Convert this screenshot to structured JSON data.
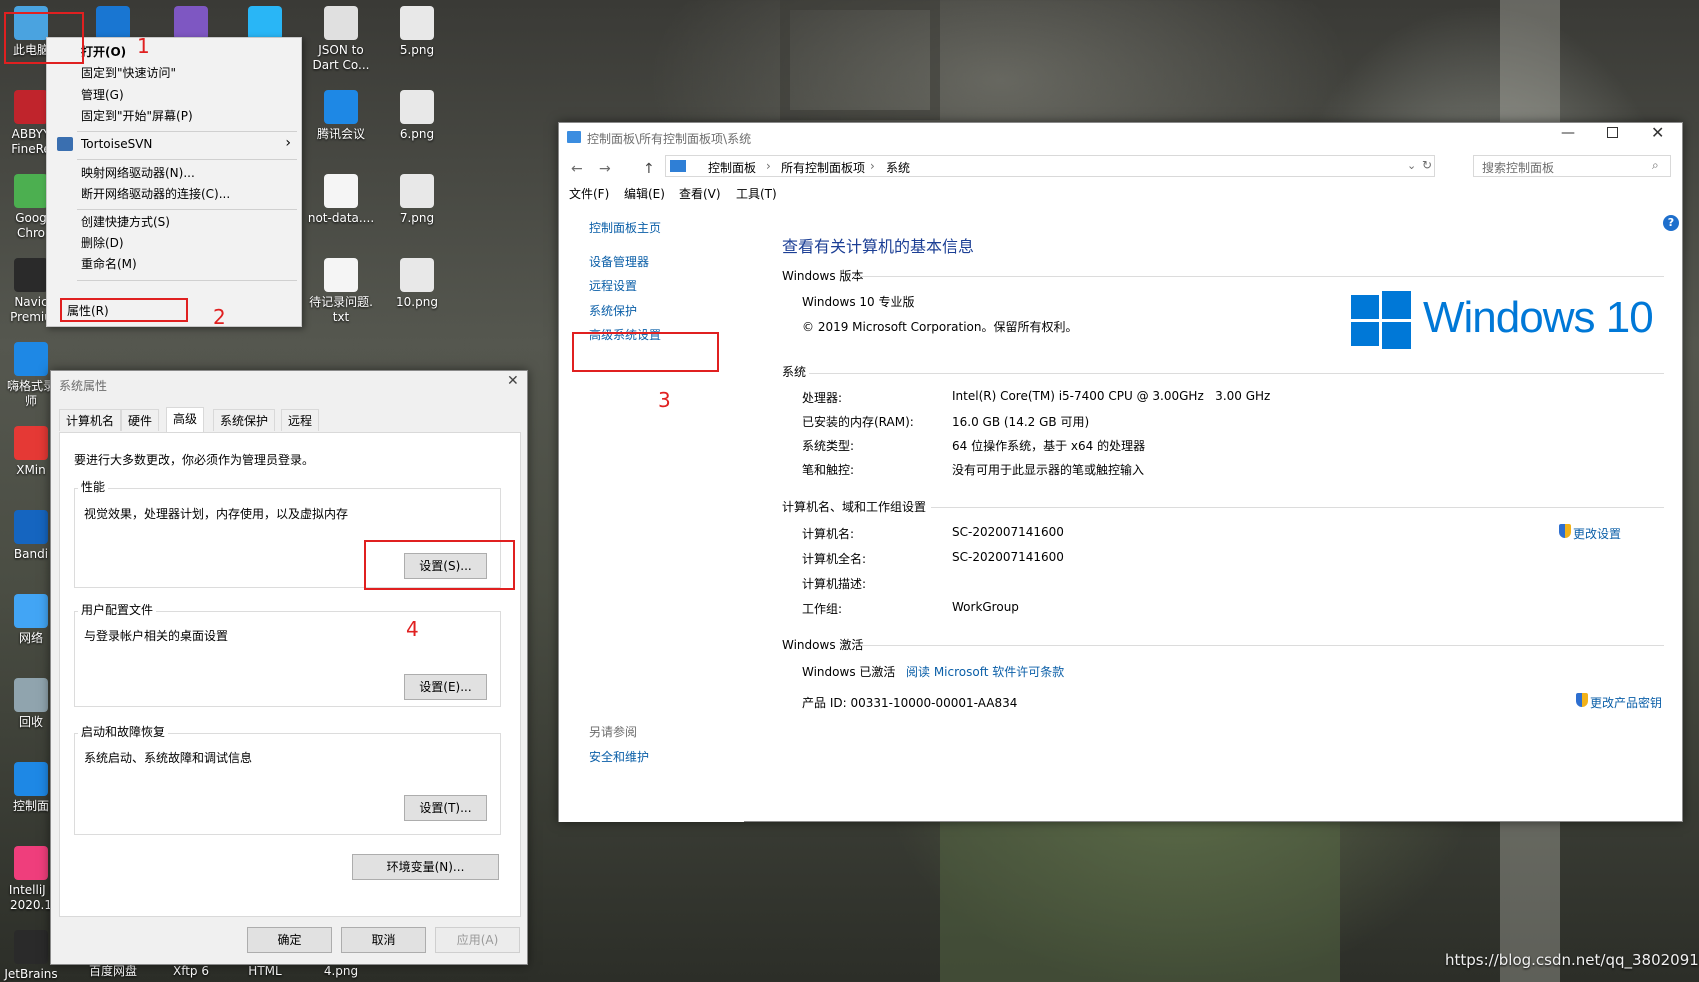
{
  "desktop": {
    "icons_col1": [
      {
        "label": "此电脑",
        "color": "#4aa3e0"
      },
      {
        "label": "ABBYY\nFineRe",
        "color": "#c0242c"
      },
      {
        "label": "Goog\nChro",
        "color": "#4caf50"
      },
      {
        "label": "Navic\nPremiu",
        "color": "#2a2a2a"
      },
      {
        "label": "嗨格式录\n师",
        "color": "#1e88e5"
      },
      {
        "label": "XMin",
        "color": "#e53935"
      },
      {
        "label": "Bandi",
        "color": "#1565c0"
      },
      {
        "label": "网络",
        "color": "#42a5f5"
      },
      {
        "label": "回收",
        "color": "#90a4ae"
      },
      {
        "label": "控制面",
        "color": "#1e88e5"
      },
      {
        "label": "IntelliJ I\n2020.1",
        "color": "#ef3e7c"
      },
      {
        "label": "JetBrains",
        "color": "#2a2a2a"
      }
    ],
    "icons_top": [
      {
        "label": "",
        "color": "#1976d2"
      },
      {
        "label": "",
        "color": "#7e57c2"
      },
      {
        "label": "",
        "color": "#29b6f6"
      },
      {
        "label": "JSON to\nDart Co...",
        "color": "#e0e0e0"
      },
      {
        "label": "5.png",
        "color": "#e8e8e8"
      }
    ],
    "icons_col4": [
      {
        "label": "腾讯会议",
        "color": "#1e88e5"
      },
      {
        "label": "not-data....",
        "color": "#f5f5f5"
      },
      {
        "label": "待记录问题.\ntxt",
        "color": "#f5f5f5"
      }
    ],
    "icons_col5": [
      {
        "label": "6.png",
        "color": "#e8e8e8"
      },
      {
        "label": "7.png",
        "color": "#e8e8e8"
      },
      {
        "label": "10.png",
        "color": "#e8e8e8"
      }
    ],
    "icons_bottom": [
      "百度网盘",
      "Xftp 6",
      "HTML",
      "4.png"
    ],
    "watermark": "https://blog.csdn.net/qq_38020915"
  },
  "context_menu": {
    "items": [
      "打开(O)",
      "固定到\"快速访问\"",
      "管理(G)",
      "固定到\"开始\"屏幕(P)",
      "TortoiseSVN",
      "映射网络驱动器(N)...",
      "断开网络驱动器的连接(C)...",
      "创建快捷方式(S)",
      "删除(D)",
      "重命名(M)",
      "属性(R)"
    ]
  },
  "annotations": [
    "1",
    "2",
    "3",
    "4"
  ],
  "system_window": {
    "title": "控制面板\\所有控制面板项\\系统",
    "breadcrumb": [
      "控制面板",
      "所有控制面板项",
      "系统"
    ],
    "search_placeholder": "搜索控制面板",
    "menu": [
      "文件(F)",
      "编辑(E)",
      "查看(V)",
      "工具(T)"
    ],
    "left_nav": [
      "控制面板主页",
      "设备管理器",
      "远程设置",
      "系统保护",
      "高级系统设置"
    ],
    "see_also": {
      "heading": "另请参阅",
      "items": [
        "安全和维护"
      ]
    },
    "heading": "查看有关计算机的基本信息",
    "edition_label": "Windows 版本",
    "edition": "Windows 10 专业版",
    "copyright": "© 2019 Microsoft Corporation。保留所有权利。",
    "logo_text": "Windows 10",
    "system_label": "系统",
    "system_rows": [
      {
        "k": "处理器:",
        "v": "Intel(R) Core(TM) i5-7400 CPU @ 3.00GHz   3.00 GHz"
      },
      {
        "k": "已安装的内存(RAM):",
        "v": "16.0 GB (14.2 GB 可用)"
      },
      {
        "k": "系统类型:",
        "v": "64 位操作系统，基于 x64 的处理器"
      },
      {
        "k": "笔和触控:",
        "v": "没有可用于此显示器的笔或触控输入"
      }
    ],
    "computer_label": "计算机名、域和工作组设置",
    "computer_rows": [
      {
        "k": "计算机名:",
        "v": "SC-202007141600"
      },
      {
        "k": "计算机全名:",
        "v": "SC-202007141600"
      },
      {
        "k": "计算机描述:",
        "v": ""
      },
      {
        "k": "工作组:",
        "v": "WorkGroup"
      }
    ],
    "change_settings": "更改设置",
    "activation_label": "Windows 激活",
    "activated": "Windows 已激活",
    "license_link": "阅读 Microsoft 软件许可条款",
    "product_id": "产品 ID: 00331-10000-00001-AA834",
    "change_key": "更改产品密钥",
    "help": "?"
  },
  "sysprops": {
    "title": "系统属性",
    "tabs": [
      "计算机名",
      "硬件",
      "高级",
      "系统保护",
      "远程"
    ],
    "admin_note": "要进行大多数更改，你必须作为管理员登录。",
    "perf_label": "性能",
    "perf_desc": "视觉效果，处理器计划，内存使用，以及虚拟内存",
    "perf_btn": "设置(S)...",
    "profile_label": "用户配置文件",
    "profile_desc": "与登录帐户相关的桌面设置",
    "profile_btn": "设置(E)...",
    "startup_label": "启动和故障恢复",
    "startup_desc": "系统启动、系统故障和调试信息",
    "startup_btn": "设置(T)...",
    "env_btn": "环境变量(N)...",
    "ok": "确定",
    "cancel": "取消",
    "apply": "应用(A)"
  }
}
